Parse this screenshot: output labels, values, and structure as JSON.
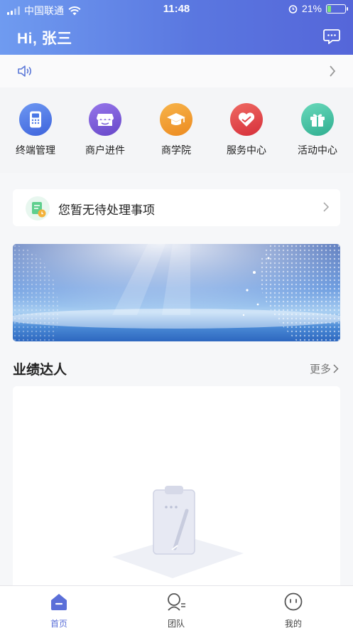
{
  "status_bar": {
    "carrier": "中国联通",
    "time": "11:48",
    "battery": "21%",
    "battery_level": 0.21
  },
  "header": {
    "greeting": "Hi, 张三"
  },
  "notice": {
    "icon": "speaker-icon"
  },
  "quick_actions": [
    {
      "label": "终端管理",
      "icon": "terminal-icon",
      "color": "#4a78e6"
    },
    {
      "label": "商户进件",
      "icon": "store-icon",
      "color": "#7358d6"
    },
    {
      "label": "商学院",
      "icon": "graduation-cap-icon",
      "color": "#f09a2e"
    },
    {
      "label": "服务中心",
      "icon": "heart-icon",
      "color": "#e2444a"
    },
    {
      "label": "活动中心",
      "icon": "gift-icon",
      "color": "#3ec1a4"
    }
  ],
  "todo": {
    "text": "您暂无待处理事项"
  },
  "performance": {
    "title": "业绩达人",
    "more": "更多"
  },
  "tabbar": {
    "items": [
      {
        "label": "首页",
        "icon": "home-icon",
        "active": true
      },
      {
        "label": "团队",
        "icon": "team-icon",
        "active": false
      },
      {
        "label": "我的",
        "icon": "profile-icon",
        "active": false
      }
    ]
  },
  "colors": {
    "header_start": "#6f9bf0",
    "header_end": "#5566d9",
    "accent": "#5b6fd8"
  }
}
